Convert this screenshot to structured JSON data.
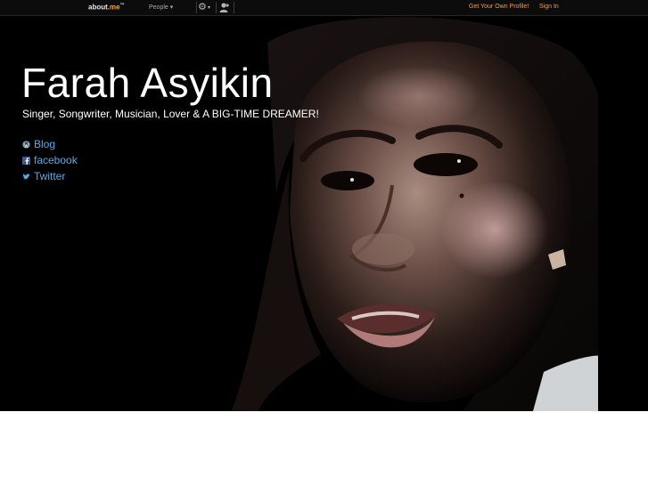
{
  "nav": {
    "logo_text": "about",
    "logo_dot": ".me",
    "logo_tm": "™",
    "people_label": "People",
    "people_caret": "▾",
    "gear_icon": "gear-icon",
    "user_icon": "user-icon",
    "get_profile_label": "Get Your Own Profile!",
    "sign_in_label": "Sign In"
  },
  "profile": {
    "name": "Farah Asyikin",
    "tagline": "Singer, Songwriter, Musician, Lover & A BIG-TIME DREAMER!",
    "links": [
      {
        "label": "Blog",
        "icon": "wordpress-icon"
      },
      {
        "label": "facebook",
        "icon": "facebook-icon"
      },
      {
        "label": "Twitter",
        "icon": "twitter-icon"
      }
    ]
  },
  "colors": {
    "link": "#5aa9e6",
    "accent": "#e8a050",
    "background": "#000000"
  }
}
